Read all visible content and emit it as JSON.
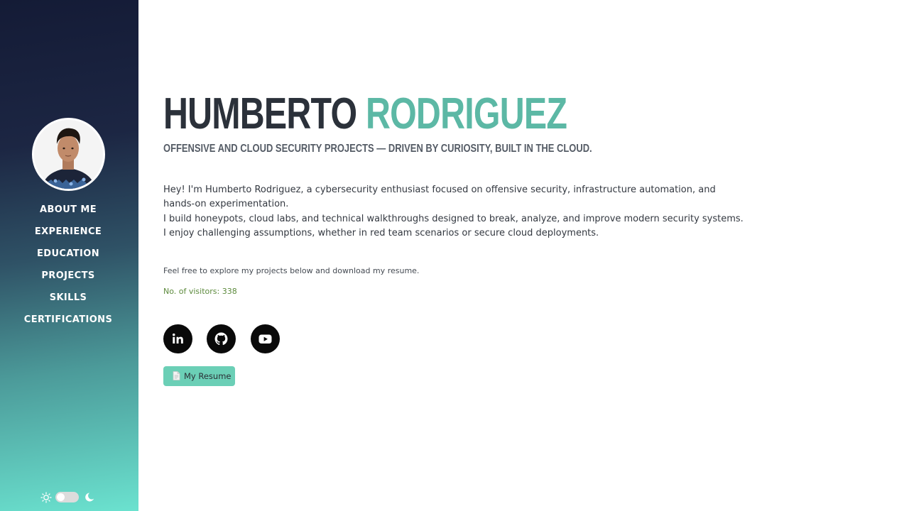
{
  "profile": {
    "first_name": "HUMBERTO",
    "last_name": "RODRIGUEZ",
    "tagline": "OFFENSIVE AND CLOUD SECURITY PROJECTS — DRIVEN BY CURIOSITY, BUILT IN THE CLOUD."
  },
  "sidebar": {
    "nav": [
      {
        "label": "ABOUT ME"
      },
      {
        "label": "EXPERIENCE"
      },
      {
        "label": "EDUCATION"
      },
      {
        "label": "PROJECTS"
      },
      {
        "label": "SKILLS"
      },
      {
        "label": "CERTIFICATIONS"
      }
    ],
    "theme_toggle": {
      "icons": [
        "sun-icon",
        "moon-icon"
      ],
      "state": "light"
    }
  },
  "about": {
    "bio_lines": [
      "Hey! I'm Humberto Rodriguez, a cybersecurity enthusiast focused on offensive security, infrastructure automation, and hands-on experimentation.",
      "I build honeypots, cloud labs, and technical walkthroughs designed to break, analyze, and improve modern security systems. I enjoy challenging assumptions, whether in red team scenarios or secure cloud deployments."
    ],
    "explore_text": "Feel free to explore my projects below and download my resume.",
    "visitors_text": "No. of visitors: 338"
  },
  "social": [
    {
      "icon": "linkedin-icon"
    },
    {
      "icon": "github-icon"
    },
    {
      "icon": "youtube-icon"
    }
  ],
  "resume_button": {
    "label": "My Resume",
    "icon": "document-icon"
  },
  "colors": {
    "accent": "#5cb8a5",
    "button": "#6bcfb6",
    "heading": "#2b313a",
    "visitors": "#5c8a3c",
    "sidebar_top": "#141b36",
    "sidebar_bottom": "#6be2cf"
  }
}
